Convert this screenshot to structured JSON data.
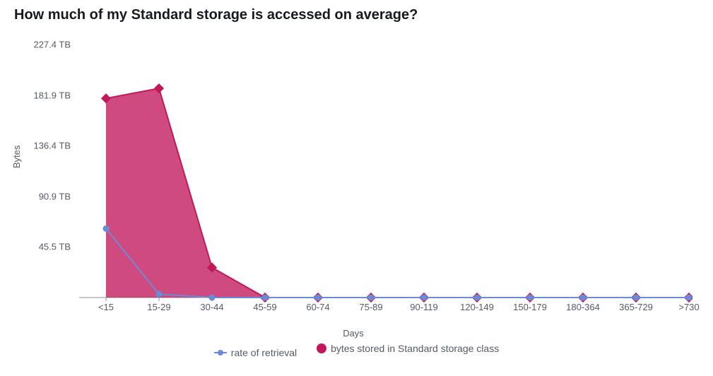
{
  "title": "How much of my Standard storage is accessed on average?",
  "legend": {
    "retrieval": "rate of retrieval",
    "bytes": "bytes stored in Standard storage class"
  },
  "chart_data": {
    "type": "area",
    "title": "How much of my Standard storage is accessed on average?",
    "xlabel": "Days",
    "ylabel": "Bytes",
    "ylim": [
      0,
      227.4
    ],
    "y_unit": "TB",
    "y_ticks": [
      45.5,
      90.9,
      136.4,
      181.9,
      227.4
    ],
    "y_tick_labels": [
      "45.5 TB",
      "90.9 TB",
      "136.4 TB",
      "181.9 TB",
      "227.4 TB"
    ],
    "categories": [
      "<15",
      "15-29",
      "30-44",
      "45-59",
      "60-74",
      "75-89",
      "90-119",
      "120-149",
      "150-179",
      "180-364",
      "365-729",
      ">730"
    ],
    "series": [
      {
        "name": "bytes stored in Standard storage class",
        "kind": "area",
        "color": "#c2185b",
        "values": [
          179,
          188,
          27,
          0,
          0,
          0,
          0,
          0,
          0,
          0,
          0,
          0
        ]
      },
      {
        "name": "rate of retrieval",
        "kind": "line",
        "color": "#6a8bd6",
        "values": [
          62,
          3,
          0,
          0,
          0,
          0,
          0,
          0,
          0,
          0,
          0,
          0
        ]
      }
    ]
  }
}
